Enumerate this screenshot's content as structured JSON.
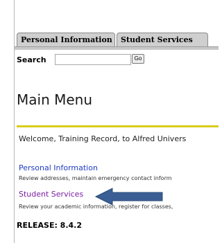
{
  "tabs": [
    {
      "label": "Personal Information"
    },
    {
      "label": "Student Services"
    }
  ],
  "search": {
    "label": "Search",
    "value": "",
    "go_label": "Go"
  },
  "page": {
    "title": "Main Menu"
  },
  "welcome": {
    "text": "Welcome, Training Record, to Alfred Univers"
  },
  "menu": [
    {
      "label": "Personal Information",
      "description": "Review addresses, maintain emergency contact inform"
    },
    {
      "label": "Student Services",
      "description": "Review your academic information, register for classes,"
    }
  ],
  "release": {
    "text": "RELEASE: 8.4.2"
  },
  "colors": {
    "accent_bar": "#d8cd1a",
    "link": "#1f3bbf",
    "visited_link": "#7a1fa2",
    "annotation_arrow": "#3b5f95"
  }
}
